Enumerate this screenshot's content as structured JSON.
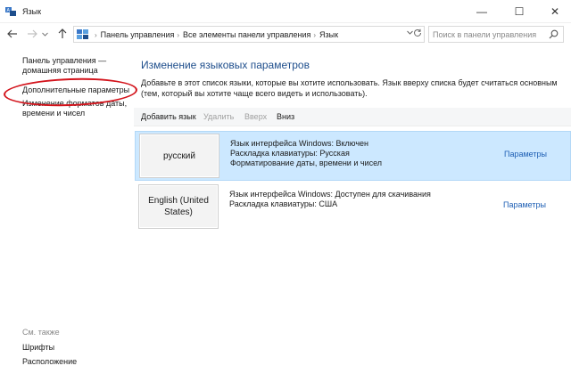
{
  "window": {
    "title": "Язык",
    "minimize_glyph": "—",
    "maximize_glyph": "☐",
    "close_glyph": "✕"
  },
  "address": {
    "breadcrumbs": [
      "Панель управления",
      "Все элементы панели управления",
      "Язык"
    ],
    "search_placeholder": "Поиск в панели управления"
  },
  "sidebar": {
    "home_link": "Панель управления — домашняя страница",
    "advanced_link": "Дополнительные параметры",
    "formats_link": "Изменение форматов даты, времени и чисел",
    "see_also": "См. также",
    "fonts_link": "Шрифты",
    "location_link": "Расположение"
  },
  "main": {
    "title": "Изменение языковых параметров",
    "description": "Добавьте в этот список языки, которые вы хотите использовать. Язык вверху списка будет считаться основным (тем, который вы хотите чаще всего видеть и использовать).",
    "toolbar": {
      "add": "Добавить язык",
      "remove": "Удалить",
      "up": "Вверх",
      "down": "Вниз"
    },
    "languages": [
      {
        "name": "русский",
        "info": [
          "Язык интерфейса Windows: Включен",
          "Раскладка клавиатуры: Русская",
          "Форматирование даты, времени и чисел"
        ],
        "options": "Параметры",
        "selected": true
      },
      {
        "name": "English (United States)",
        "info": [
          "Язык интерфейса Windows: Доступен для скачивания",
          "Раскладка клавиатуры: США"
        ],
        "options": "Параметры",
        "selected": false
      }
    ]
  },
  "colors": {
    "accent_link": "#1e5fb4",
    "title_blue": "#1e4e8c",
    "selected_row": "#cce8ff",
    "annotation_red": "#d3141c"
  },
  "icons": [
    "control-panel-icon",
    "back-arrow-icon",
    "forward-arrow-icon",
    "up-arrow-icon",
    "refresh-icon",
    "search-icon"
  ]
}
